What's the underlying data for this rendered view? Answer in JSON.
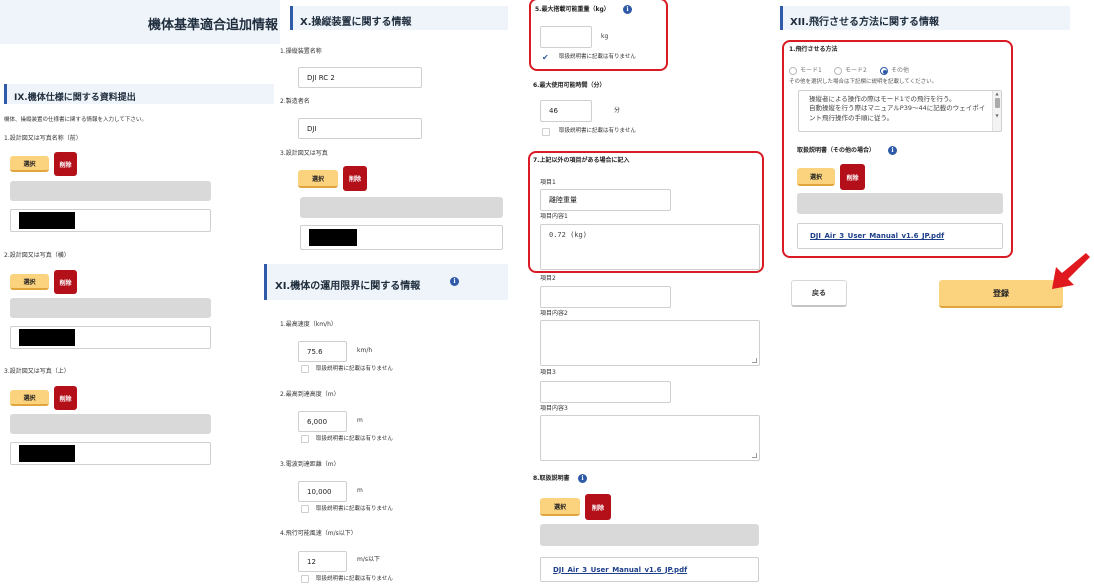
{
  "col1": {
    "title": "機体基準適合追加情報",
    "section9": "IX.機体仕様に関する資料提出",
    "desc": "機体、操縦装置の仕様書に関する情報を入力して下さい。",
    "fields": [
      {
        "label": "1.設計図又は写真名称（前）"
      },
      {
        "label": "2.設計図又は写真（横）"
      },
      {
        "label": "3.設計図又は写真（上）"
      }
    ],
    "select": "選択",
    "delete": "削除"
  },
  "col2": {
    "section10": "X.操縦装置に関する情報",
    "f1_label": "1.操縦装置名称",
    "f1_value": "DJI RC 2",
    "f2_label": "2.製造者名",
    "f2_value": "DJI",
    "f3_label": "3.設計図又は写真",
    "select": "選択",
    "delete": "削除",
    "section11": "XI.機体の運用限界に関する情報",
    "speed_label": "1.最高速度（km/h）",
    "speed_value": "75.6",
    "speed_unit": "km/h",
    "altitude_label": "2.最高到達高度（m）",
    "altitude_value": "6,000",
    "altitude_unit": "m",
    "radio_label": "3.電波到達距離（m）",
    "radio_value": "10,000",
    "radio_unit": "m",
    "wind_label": "4.飛行可能風速（m/s以下）",
    "wind_value": "12",
    "wind_unit": "m/s以下",
    "not_in_manual": "取扱説明書に記載は有りません"
  },
  "col3": {
    "payload_label": "5.最大搭載可能重量（kg）",
    "payload_unit": "kg",
    "payload_note": "取扱説明書に記載は有りません",
    "time_label": "6.最大使用可能時間（分）",
    "time_value": "46",
    "time_unit": "分",
    "time_note": "取扱説明書に記載は有りません",
    "other_label": "7.上記以外の項目がある場合に記入",
    "item1_label": "項目1",
    "item1_value": "離陸重量",
    "content1_label": "項目内容1",
    "content1_value": "0.72 (kg)",
    "item2_label": "項目2",
    "content2_label": "項目内容2",
    "item3_label": "項目3",
    "content3_label": "項目内容3",
    "manual_label": "8.取扱説明書",
    "select": "選択",
    "delete": "削除",
    "file": "DJI_Air_3_User_Manual_v1.6_JP.pdf"
  },
  "col4": {
    "section12": "XII.飛行させる方法に関する情報",
    "method_label": "1.飛行させる方法",
    "mode1": "モード1",
    "mode2": "モード2",
    "other": "その他",
    "other_note": "その他を選択した場合は下記欄に説明を記載してください。",
    "method_text": "操縦者による操作の際はモード1での飛行を行う。\n自動操縦を行う際はマニュアルP39～44に記載のウェイポイント飛行操作の手順に従う。",
    "manual_other_label": "取扱説明書（その他の場合）",
    "select": "選択",
    "delete": "削除",
    "file": "DJI_Air_3_User_Manual_v1.6_JP.pdf",
    "back": "戻る",
    "register": "登録"
  },
  "colors": {
    "accent_red": "#d81b24",
    "button_yellow": "#fbd27e",
    "delete_red": "#b3101a",
    "link_blue": "#1e3f8a",
    "info_blue": "#2e5aa8",
    "header_bg": "#eef4fa"
  }
}
